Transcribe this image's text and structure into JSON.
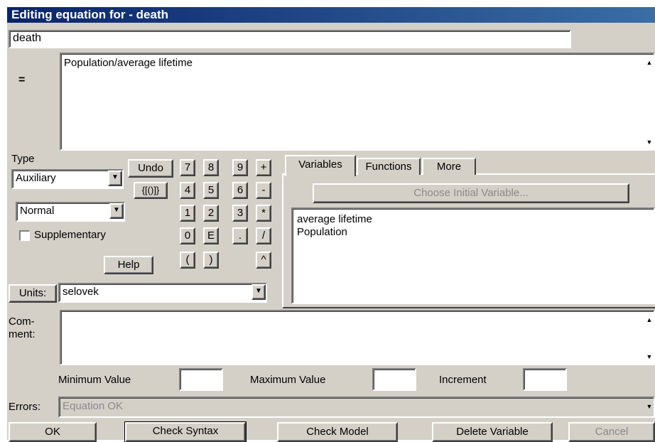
{
  "window": {
    "title": "Editing equation for - death"
  },
  "variable_name": "death",
  "equals_label": "=",
  "equation": "Population/average lifetime",
  "type": {
    "label": "Type",
    "selected": "Auxiliary",
    "subtype_selected": "Normal",
    "supplementary_label": "Supplementary",
    "supplementary_checked": false
  },
  "buttons": {
    "undo": "Undo",
    "brackets": "{[()]}",
    "help": "Help",
    "units": "Units:",
    "ok": "OK",
    "check_syntax": "Check Syntax",
    "check_model": "Check Model",
    "delete_variable": "Delete Variable",
    "cancel": "Cancel"
  },
  "keypad": {
    "r1": [
      "7",
      "8",
      "9",
      "+"
    ],
    "r2": [
      "4",
      "5",
      "6",
      "-"
    ],
    "r3": [
      "1",
      "2",
      "3",
      "*"
    ],
    "r4": [
      "0",
      "E",
      ".",
      "/"
    ],
    "r5": [
      "(",
      ")",
      "^"
    ]
  },
  "tabs": [
    "Variables",
    "Functions",
    "More"
  ],
  "choose_initial": "Choose Initial Variable...",
  "variables": [
    "average lifetime",
    "Population"
  ],
  "units": {
    "value": "selovek"
  },
  "comment": {
    "label_line1": "Com-",
    "label_line2": "ment:",
    "value": ""
  },
  "ranges": {
    "min_label": "Minimum Value",
    "max_label": "Maximum Value",
    "inc_label": "Increment",
    "min_value": "",
    "max_value": "",
    "inc_value": ""
  },
  "errors": {
    "label": "Errors:",
    "value": "Equation OK"
  }
}
